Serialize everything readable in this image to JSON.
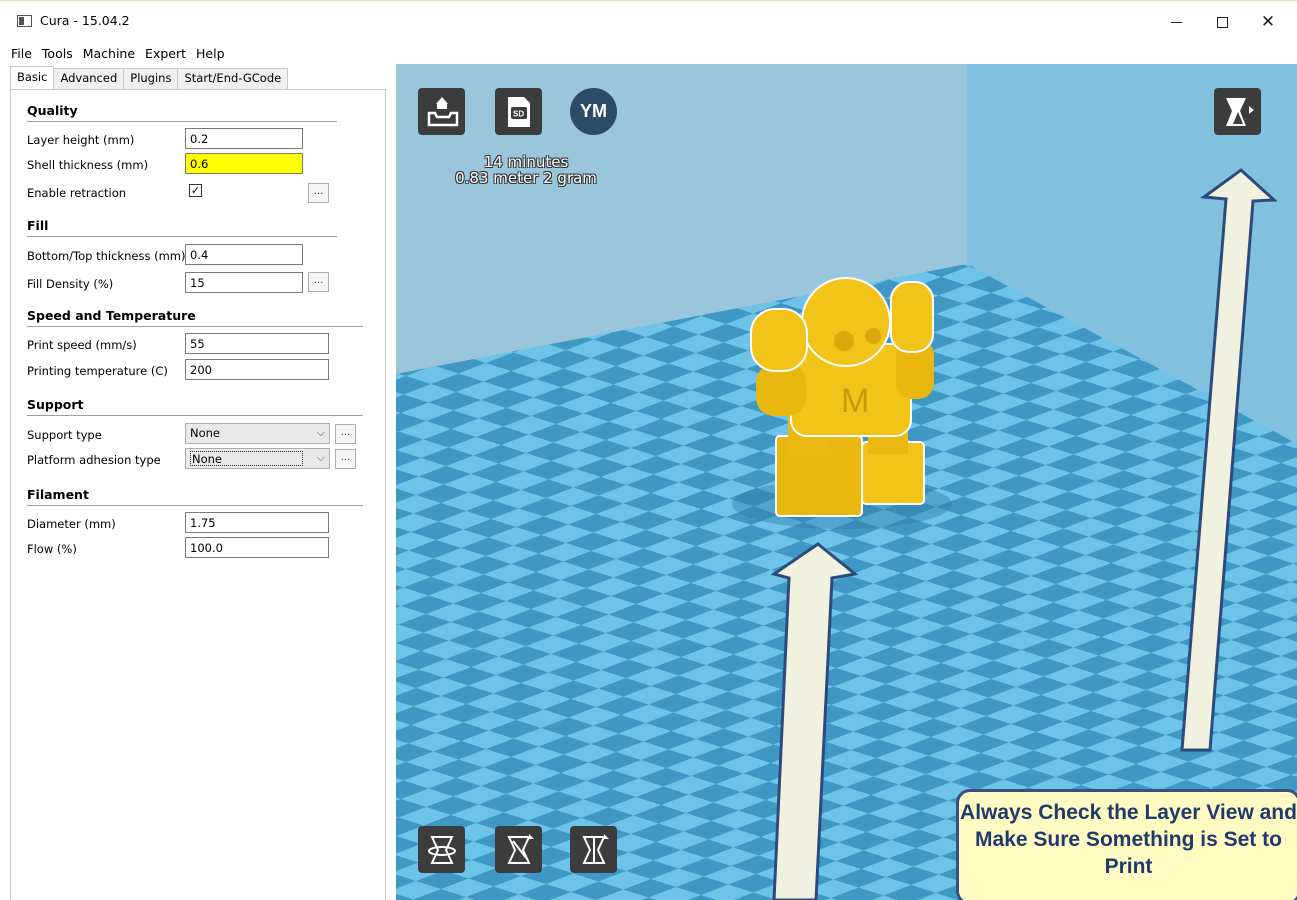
{
  "window": {
    "title": "Cura - 15.04.2",
    "controls": {
      "minimize": "minimize",
      "maximize": "maximize",
      "close": "close"
    }
  },
  "menu": [
    "File",
    "Tools",
    "Machine",
    "Expert",
    "Help"
  ],
  "tabs": [
    "Basic",
    "Advanced",
    "Plugins",
    "Start/End-GCode"
  ],
  "sections": {
    "quality": {
      "title": "Quality",
      "layer_height": {
        "label": "Layer height (mm)",
        "value": "0.2"
      },
      "shell_thickness": {
        "label": "Shell thickness (mm)",
        "value": "0.6"
      },
      "enable_retraction": {
        "label": "Enable retraction",
        "checked": true
      }
    },
    "fill": {
      "title": "Fill",
      "bottom_top": {
        "label": "Bottom/Top thickness (mm)",
        "value": "0.4"
      },
      "fill_density": {
        "label": "Fill Density (%)",
        "value": "15"
      }
    },
    "speed": {
      "title": "Speed and Temperature",
      "print_speed": {
        "label": "Print speed (mm/s)",
        "value": "55"
      },
      "print_temp": {
        "label": "Printing temperature (C)",
        "value": "200"
      }
    },
    "support": {
      "title": "Support",
      "support_type": {
        "label": "Support type",
        "value": "None"
      },
      "adhesion": {
        "label": "Platform adhesion type",
        "value": "None"
      }
    },
    "filament": {
      "title": "Filament",
      "diameter": {
        "label": "Diameter (mm)",
        "value": "1.75"
      },
      "flow": {
        "label": "Flow (%)",
        "value": "100.0"
      }
    },
    "more_button": "..."
  },
  "viewport": {
    "top_buttons": [
      "load-icon",
      "sd-card-icon",
      "youmagine-icon"
    ],
    "youmagine_label": "YM",
    "sd_label": "SD",
    "print_time": "14 minutes",
    "print_material": "0.83 meter 2 gram",
    "bottom_buttons": [
      "rotate-icon",
      "scale-icon",
      "mirror-icon"
    ],
    "view_mode_button": "view-mode-icon",
    "callout_text": "Always Check the Layer View and Make Sure Something is Set to Print",
    "colors": {
      "floor_light": "#6ec4e8",
      "floor_dark": "#3f97c3",
      "wall_back": "#9ac6dc",
      "wall_right": "#82c0e0",
      "model": "#f2c318",
      "callout_bg": "#fffbc3",
      "callout_border": "#3c4f7c",
      "arrow_fill": "#f1f1e0",
      "arrow_stroke": "#2e4a7a"
    }
  }
}
